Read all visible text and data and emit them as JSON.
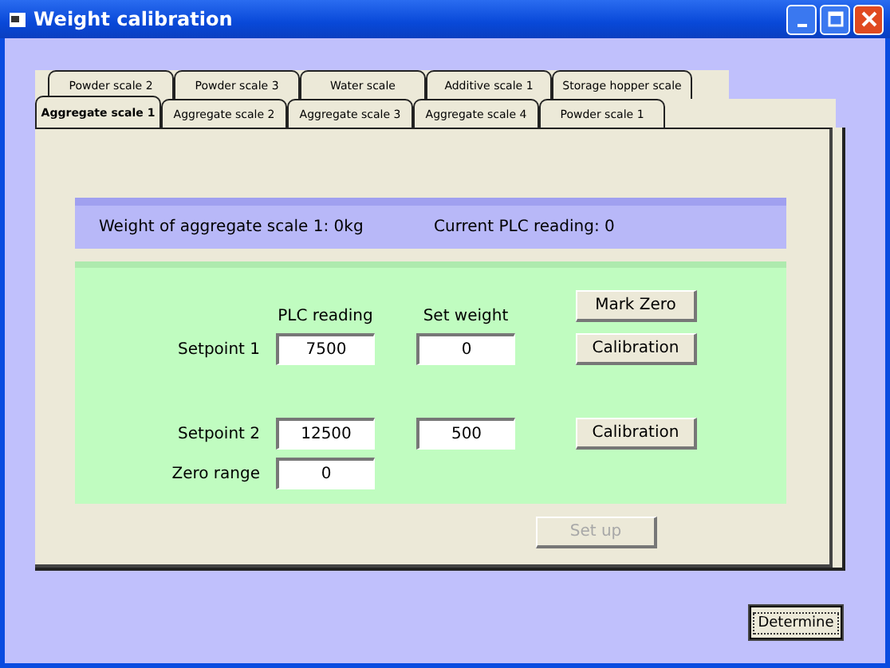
{
  "window": {
    "title": "Weight calibration"
  },
  "tab_rows": [
    {
      "tabs": [
        {
          "label": "Powder scale 2",
          "selected": false
        },
        {
          "label": "Powder scale 3",
          "selected": false
        },
        {
          "label": "Water scale",
          "selected": false
        },
        {
          "label": "Additive scale 1",
          "selected": false
        },
        {
          "label": "Storage hopper scale",
          "selected": false
        }
      ]
    },
    {
      "tabs": [
        {
          "label": "Aggregate scale 1",
          "selected": true
        },
        {
          "label": "Aggregate scale 2",
          "selected": false
        },
        {
          "label": "Aggregate scale 3",
          "selected": false
        },
        {
          "label": "Aggregate scale 4",
          "selected": false
        },
        {
          "label": "Powder scale 1",
          "selected": false
        }
      ]
    }
  ],
  "status": {
    "weight": "Weight of aggregate scale 1: 0kg",
    "plc_reading": "Current PLC reading: 0"
  },
  "calibration": {
    "column_headers": [
      "PLC reading",
      "Set weight"
    ],
    "mark_zero_button": "Mark Zero",
    "setpoints": [
      {
        "label": "Setpoint 1",
        "plc_reading": "7500",
        "set_weight": "0",
        "button": "Calibration"
      },
      {
        "label": "Setpoint 2",
        "plc_reading": "12500",
        "set_weight": "500",
        "button": "Calibration"
      }
    ],
    "zero_range": {
      "label": "Zero range",
      "value": "0"
    }
  },
  "setup_button": {
    "label": "Set up",
    "disabled": true
  },
  "determine_button": {
    "label": "Determine",
    "focused": true
  }
}
